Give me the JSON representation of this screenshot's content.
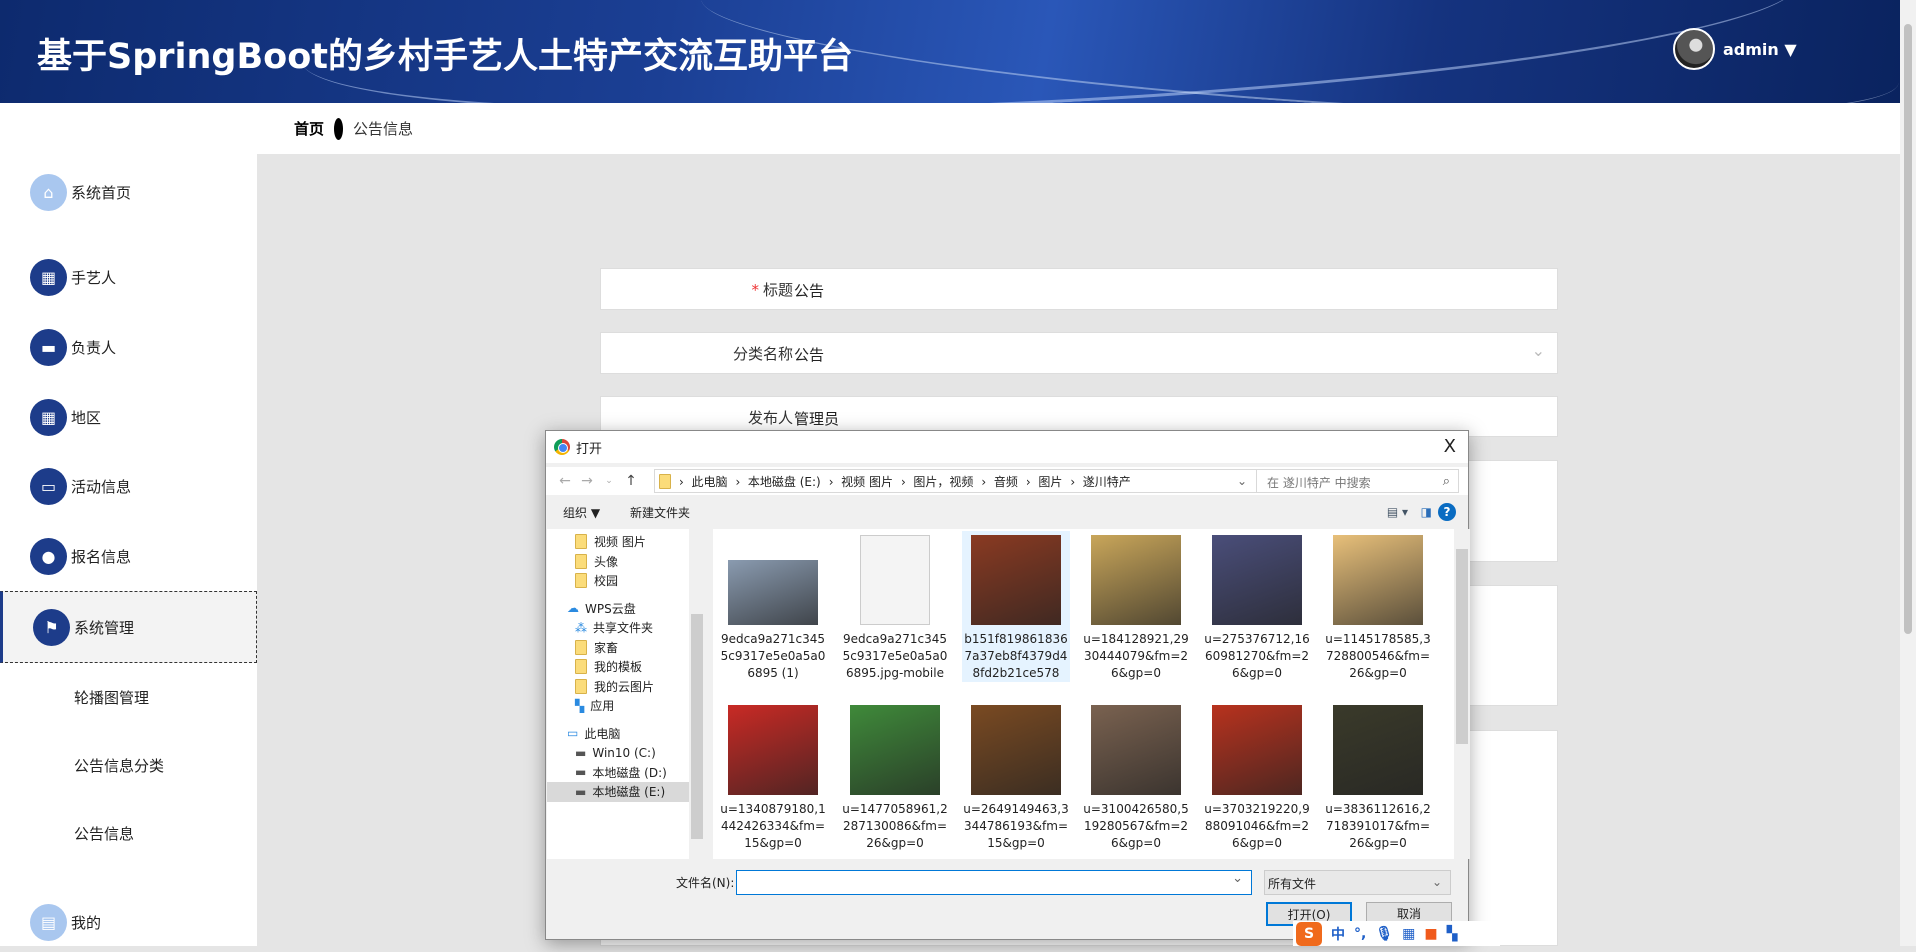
{
  "header": {
    "title": "基于SpringBoot的乡村手艺人土特产交流互助平台",
    "user": "admin ▼"
  },
  "breadcrumb": {
    "home": "首页",
    "current": "公告信息"
  },
  "sidebar": {
    "items": [
      {
        "label": "系统首页",
        "icon": "⌂"
      },
      {
        "label": "手艺人",
        "icon": "▦"
      },
      {
        "label": "负责人",
        "icon": "▬"
      },
      {
        "label": "地区",
        "icon": "▦"
      },
      {
        "label": "活动信息",
        "icon": "▭"
      },
      {
        "label": "报名信息",
        "icon": "●"
      },
      {
        "label": "系统管理",
        "icon": "⚑"
      }
    ],
    "sub": [
      "轮播图管理",
      "公告信息分类",
      "公告信息"
    ],
    "mine": {
      "label": "我的",
      "icon": "▤"
    }
  },
  "form": {
    "rows": [
      {
        "label": "标题",
        "value": "公告",
        "required": "*"
      },
      {
        "label": "分类名称",
        "value": "公告",
        "chevron": "⌄"
      },
      {
        "label": "发布人",
        "value": "管理员"
      }
    ]
  },
  "dialog": {
    "title": "打开",
    "close": "X",
    "path": [
      "此电脑",
      "本地磁盘 (E:)",
      "视频 图片",
      "图片，视频",
      "音频",
      "图片",
      "遂川特产"
    ],
    "search_placeholder": "在 遂川特产 中搜索",
    "toolbar": {
      "organize": "组织 ▼",
      "new_folder": "新建文件夹",
      "help": "?"
    },
    "nav": [
      "视频 图片",
      "头像",
      "校园",
      "WPS云盘",
      "共享文件夹",
      "家畜",
      "我的模板",
      "我的云图片",
      "应用",
      "此电脑",
      "Win10 (C:)",
      "本地磁盘 (D:)",
      "本地磁盘 (E:)"
    ],
    "files": [
      {
        "name": "9edca9a271c3455c9317e5e0a5a06895 (1)",
        "color": "#8a9bb0"
      },
      {
        "name": "9edca9a271c3455c9317e5e0a5a06895.jpg-mobile",
        "color": "#f4f4f4"
      },
      {
        "name": "b151f8198618367a37eb8f4379d48fd2b21ce578",
        "color": "#8a3a22"
      },
      {
        "name": "u=184128921,2930444079&fm=26&gp=0",
        "color": "#c9a65a"
      },
      {
        "name": "u=275376712,1660981270&fm=26&gp=0",
        "color": "#4a4e7a"
      },
      {
        "name": "u=1145178585,3728800546&fm=26&gp=0",
        "color": "#e8c07a"
      },
      {
        "name": "u=1340879180,1442426334&fm=15&gp=0",
        "color": "#c92a25"
      },
      {
        "name": "u=1477058961,2287130086&fm=26&gp=0",
        "color": "#3f8a3a"
      },
      {
        "name": "u=2649149463,3344786193&fm=15&gp=0",
        "color": "#7a4a22"
      },
      {
        "name": "u=3100426580,519280567&fm=26&gp=0",
        "color": "#7a6250"
      },
      {
        "name": "u=3703219220,988091046&fm=26&gp=0",
        "color": "#b8321e"
      },
      {
        "name": "u=3836112616,2718391017&fm=26&gp=0",
        "color": "#3a3a2a"
      }
    ],
    "filename_label": "文件名(N):",
    "filename_value": "",
    "filter": "所有文件",
    "open": "打开(O)",
    "cancel": "取消"
  },
  "ime": {
    "logo": "S",
    "mode": "中",
    "punct": "°,"
  }
}
